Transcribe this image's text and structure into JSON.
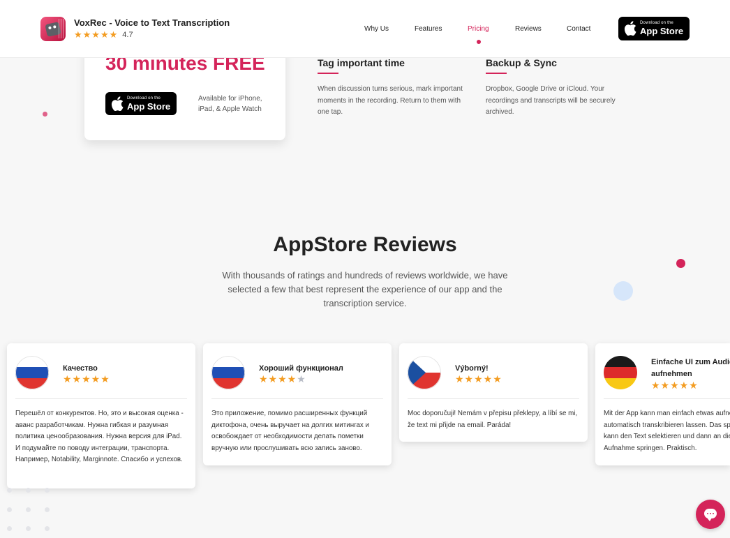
{
  "header": {
    "app_name": "VoxRec - Voice to Text Transcription",
    "rating_stars": "★★★★★",
    "rating_value": "4.7",
    "nav": [
      {
        "label": "Why Us",
        "active": false
      },
      {
        "label": "Features",
        "active": false
      },
      {
        "label": "Pricing",
        "active": true
      },
      {
        "label": "Reviews",
        "active": false
      },
      {
        "label": "Contact",
        "active": false
      }
    ],
    "appstore_small": "Download on the",
    "appstore_big": "App Store"
  },
  "promo": {
    "title": "30 minutes FREE",
    "appstore_small": "Download on the",
    "appstore_big": "App Store",
    "availability": "Available for iPhone, iPad, & Apple Watch"
  },
  "features": [
    {
      "title": "Tag important time",
      "text": "When discussion turns serious, mark important moments in the recording. Return to them with one tap."
    },
    {
      "title": "Backup & Sync",
      "text": "Dropbox, Google Drive or iCloud. Your recordings and transcripts will be securely archived."
    }
  ],
  "reviews_section": {
    "title": "AppStore Reviews",
    "subtitle": "With thousands of ratings and hundreds of reviews worldwide, we have selected a few that best represent the experience of our app and the transcription service."
  },
  "reviews": [
    {
      "flag": "russia",
      "title": "Качество",
      "stars": "★★★★★",
      "stars_off": "",
      "body": "Перешёл от конкурентов. Но, это и высокая оценка - аванс разработчикам. Нужна гибкая и разумная политика ценообразования. Нужна версия для iPad. И подумайте по поводу интеграции, транспорта. Например, Notability, Marginnote. Спасибо и успехов."
    },
    {
      "flag": "russia",
      "title": "Хороший функционал",
      "stars": "★★★★",
      "stars_off": "★",
      "body": "Это приложение, помимо расширенных функций диктофона, очень выручает на долгих митингах и освобождает от необходимости делать пометки вручную или прослушивать всю запись заново."
    },
    {
      "flag": "czech",
      "title": "Výborný!",
      "stars": "★★★★★",
      "stars_off": "",
      "body": "Moc doporučuji! Nemám v přepisu překlepy, a líbí se mi, že text mi přijde na email. Paráda!"
    },
    {
      "flag": "germany",
      "title": "Einfache UI zum Audio aufnehmen",
      "stars": "★★★★★",
      "stars_off": "",
      "body": "Mit der App kann man einfach etwas aufnehmen und automatisch transkribieren lassen. Das spart Zeit. Man kann den Text selektieren und dann an die Stelle in der Aufnahme springen. Praktisch."
    }
  ],
  "colors": {
    "accent": "#d4245a",
    "star": "#f39c21",
    "light_blue_dot": "#d6e6fa"
  },
  "icons": [
    "apple-icon",
    "chat-icon",
    "app-icon"
  ]
}
